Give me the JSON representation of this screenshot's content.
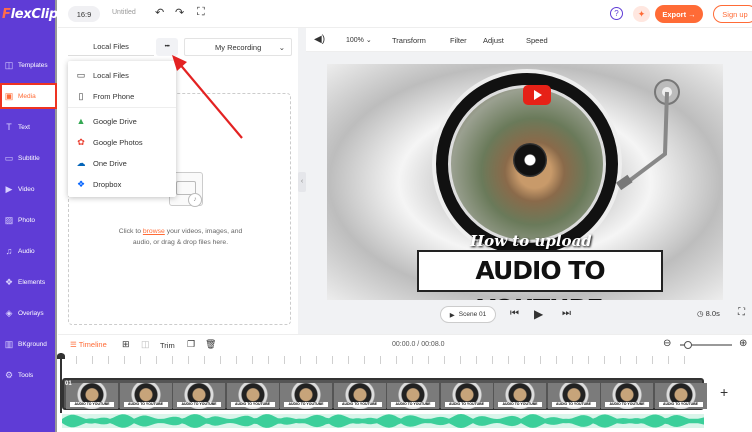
{
  "app": {
    "name_prefix": "F",
    "name_rest": "lexClip"
  },
  "sidebar": {
    "items": [
      {
        "label": "Templates",
        "icon": "templates-icon",
        "glyph": "◫"
      },
      {
        "label": "Media",
        "icon": "folder-icon",
        "glyph": "▣"
      },
      {
        "label": "Text",
        "icon": "text-icon",
        "glyph": "T"
      },
      {
        "label": "Subtitle",
        "icon": "subtitle-icon",
        "glyph": "▭"
      },
      {
        "label": "Video",
        "icon": "video-icon",
        "glyph": "▶"
      },
      {
        "label": "Photo",
        "icon": "photo-icon",
        "glyph": "▨"
      },
      {
        "label": "Audio",
        "icon": "audio-icon",
        "glyph": "♫"
      },
      {
        "label": "Elements",
        "icon": "elements-icon",
        "glyph": "❖"
      },
      {
        "label": "Overlays",
        "icon": "overlays-icon",
        "glyph": "◈"
      },
      {
        "label": "BKground",
        "icon": "background-icon",
        "glyph": "▥"
      },
      {
        "label": "Tools",
        "icon": "tools-icon",
        "glyph": "⚙"
      }
    ]
  },
  "topbar": {
    "ratio": "16:9",
    "title": "Untitled",
    "export_label": "Export →",
    "signup_label": "Sign up",
    "help_glyph": "?"
  },
  "media_panel": {
    "tab_local": "Local Files",
    "more_glyph": "•••",
    "tab_recording": "My Recording",
    "menu": [
      {
        "label": "Local Files",
        "icon": "monitor-icon",
        "glyph": "▭",
        "color": "#333333"
      },
      {
        "label": "From Phone",
        "icon": "phone-icon",
        "glyph": "▯",
        "color": "#333333"
      },
      {
        "label": "Google Drive",
        "icon": "google-drive-icon",
        "glyph": "▲",
        "color": "#34a853"
      },
      {
        "label": "Google Photos",
        "icon": "google-photos-icon",
        "glyph": "✿",
        "color": "#ea4335"
      },
      {
        "label": "One Drive",
        "icon": "onedrive-icon",
        "glyph": "☁",
        "color": "#0364b8"
      },
      {
        "label": "Dropbox",
        "icon": "dropbox-icon",
        "glyph": "❖",
        "color": "#0061fe"
      }
    ],
    "upload_text_before": "Click to ",
    "upload_link": "browse",
    "upload_text_after": " your videos, images, and audio, or drag & drop files here."
  },
  "stage_toolbar": {
    "zoom": "100%",
    "items": [
      "Transform",
      "Filter",
      "Adjust",
      "Speed"
    ]
  },
  "preview": {
    "script_title": "How to upload",
    "main_title": "AUDIO TO YOUTUBE"
  },
  "playback": {
    "scene_label": "Scene 01",
    "duration": "8.0s"
  },
  "timeline": {
    "label": "Timeline",
    "trim_label": "Trim",
    "time": "00:00.0 / 00:08.0",
    "scene_no": "01",
    "frame_caption": "AUDIO TO YOUTUBE",
    "add_glyph": "+"
  },
  "colors": {
    "brand_purple": "#5f3cd6",
    "accent_orange": "#ff6b36",
    "highlight_red": "#e32222",
    "audio_green": "#3ccf9a"
  }
}
